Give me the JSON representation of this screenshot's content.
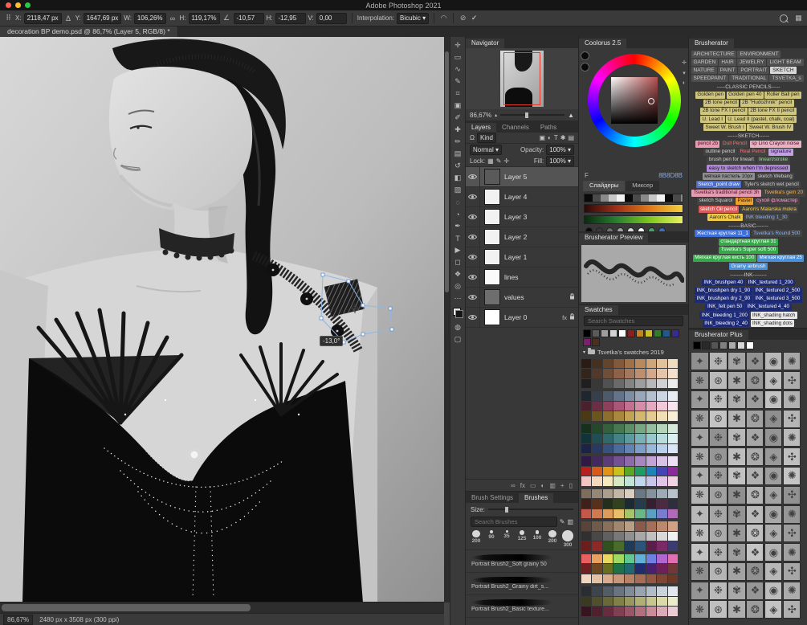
{
  "icons": {
    "ref_point": "⠿",
    "delta": "Δ",
    "link": "∞",
    "angle": "∠",
    "warp": "◠",
    "cancel": "⊘",
    "commit": "✓",
    "workspace": "▦",
    "dropdown": "▾",
    "expand": "▾",
    "filter_omega": "Ω",
    "f1": "▣",
    "f2": "◐",
    "f3": "T",
    "f4": "✱",
    "f5": "▤",
    "lock_transp": "▦",
    "lock_paint": "✎",
    "lock_move": "✛",
    "foot_link": "∞",
    "foot_fx": "fx",
    "foot_adj": "◐",
    "foot_mask": "▭",
    "foot_group": "▥",
    "foot_new": "+",
    "foot_del": "▯",
    "mountain_small": "▴",
    "mountain_big": "▲",
    "brush_edit": "✎",
    "brush_folder": "▥",
    "cool_r1": "✛",
    "cool_r2": "▾",
    "cool_r3": "◐"
  },
  "menubar": {
    "title": "Adobe Photoshop 2021"
  },
  "traffic_lights": {
    "red": "#ff5f57",
    "yellow": "#febc2e",
    "green": "#28c840"
  },
  "options_bar": {
    "x_label": "X:",
    "x_value": "2118,47 px",
    "y_label": "Y:",
    "y_value": "1647,69 px",
    "w_label": "W:",
    "w_value": "106,26%",
    "h_label": "H:",
    "h_value": "119,17%",
    "rotate_value": "-10,57",
    "skew_h_label": "H:",
    "skew_h_value": "-12,95",
    "skew_v_label": "V:",
    "skew_v_value": "0,00",
    "interp_label": "Interpolation:",
    "interp_value": "Bicubic"
  },
  "document_tab": {
    "title": "decoration BP demo.psd @ 86,7% (Layer 5, RGB/8) *"
  },
  "toolbar": {
    "tools": [
      {
        "name": "move-tool",
        "glyph": "✛"
      },
      {
        "name": "marquee-tool",
        "glyph": "▭"
      },
      {
        "name": "lasso-tool",
        "glyph": "∿"
      },
      {
        "name": "quick-selection-tool",
        "glyph": "✎"
      },
      {
        "name": "crop-tool",
        "glyph": "⌗"
      },
      {
        "name": "frame-tool",
        "glyph": "▣"
      },
      {
        "name": "eyedropper-tool",
        "glyph": "✐"
      },
      {
        "name": "healing-brush-tool",
        "glyph": "✚"
      },
      {
        "name": "brush-tool",
        "glyph": "✏"
      },
      {
        "name": "clone-stamp-tool",
        "glyph": "▤"
      },
      {
        "name": "history-brush-tool",
        "glyph": "↺"
      },
      {
        "name": "eraser-tool",
        "glyph": "◧"
      },
      {
        "name": "gradient-tool",
        "glyph": "▨"
      },
      {
        "name": "blur-tool",
        "glyph": "◌"
      },
      {
        "name": "dodge-tool",
        "glyph": "◔"
      },
      {
        "name": "pen-tool",
        "glyph": "✒"
      },
      {
        "name": "type-tool",
        "glyph": "T"
      },
      {
        "name": "path-selection-tool",
        "glyph": "▶"
      },
      {
        "name": "shape-tool",
        "glyph": "◻"
      },
      {
        "name": "hand-tool",
        "glyph": "❖"
      },
      {
        "name": "zoom-tool",
        "glyph": "◎"
      },
      {
        "name": "edit-toolbar",
        "glyph": "⋯"
      }
    ],
    "below_tools": [
      {
        "name": "quick-mask-toggle",
        "glyph": "◍"
      },
      {
        "name": "screen-mode-toggle",
        "glyph": "▢"
      }
    ]
  },
  "navigator": {
    "title": "Navigator",
    "zoom": "86,67%"
  },
  "layers_panel": {
    "tabs": [
      "Layers",
      "Channels",
      "Paths"
    ],
    "filter_label": "Kind",
    "blend_mode": "Normal",
    "opacity_label": "Opacity:",
    "opacity_value": "100%",
    "lock_label": "Lock:",
    "fill_label": "Fill:",
    "fill_value": "100%",
    "layers": [
      {
        "name": "Layer 5",
        "selected": true,
        "thumb": "#5a5a5a"
      },
      {
        "name": "Layer 4",
        "thumb": "#f2f2f2"
      },
      {
        "name": "Layer 3",
        "thumb": "#f2f2f2"
      },
      {
        "name": "Layer 2",
        "thumb": "#f2f2f2"
      },
      {
        "name": "Layer 1",
        "thumb": "#f2f2f2"
      },
      {
        "name": "lines",
        "thumb": "#fafafa"
      },
      {
        "name": "values",
        "thumb": "#6e6e6e",
        "locked": true
      },
      {
        "name": "Layer 0",
        "thumb": "#ffffff",
        "fx": true,
        "locked": true
      }
    ]
  },
  "brushes_panel": {
    "tabs": [
      "Brush Settings",
      "Brushes"
    ],
    "size_label": "Size:",
    "search_placeholder": "Search Brushes",
    "sizes": [
      "200",
      "90",
      "35",
      "125",
      "100",
      "200",
      "300"
    ],
    "brushes": [
      "Portrait Brush2_Soft grainy 50",
      "Portrait Brush2_Grainy dirt_s...",
      "Portrait Brush2_Basic texture..."
    ]
  },
  "coolorus": {
    "title": "Coolorus 2.5",
    "hex_prefix": "F",
    "hex_value": "8B8D8B",
    "tabs": [
      "Слайдеры",
      "Миксер"
    ],
    "dots": [
      "#0a0a0a",
      "#3a3a3a",
      "#6e6e6e",
      "#a2a2a2",
      "#d6d6d6",
      "#ffffff",
      "#4aa06a",
      "#3a6ec0"
    ]
  },
  "brusherator_preview": {
    "title": "Brusherator Preview"
  },
  "swatches_panel": {
    "title": "Swatches",
    "search_placeholder": "Search Swatches",
    "folder_name": "Tsvetka's swatches 2019",
    "standard": [
      "#000000",
      "#5a5a5a",
      "#9e9e9e",
      "#d4d4d4",
      "#ffffff",
      "#8c1f1f",
      "#c4841f",
      "#ccc01e",
      "#2e7c2e",
      "#1f5a8c",
      "#3a2a8c",
      "#7c1f6e",
      "#4a3020"
    ],
    "groups": [
      [
        "#2a1c14",
        "#46301f",
        "#64452c",
        "#82593a",
        "#a07048",
        "#b98a5e",
        "#cfa67a",
        "#e2c29a",
        "#f0dcc0"
      ],
      [
        "#33241c",
        "#52392b",
        "#6f4e3a",
        "#8c634a",
        "#a4785c",
        "#bc8f72",
        "#d2a98c",
        "#e4c4aa",
        "#f2dfcc"
      ],
      [
        "#1f1f1f",
        "#383838",
        "#515151",
        "#6a6a6a",
        "#848484",
        "#9e9e9e",
        "#b8b8b8",
        "#d2d2d2",
        "#ececec"
      ],
      [
        "#20262e",
        "#36404c",
        "#4c5a6a",
        "#647488",
        "#7e8ea2",
        "#98a8ba",
        "#b2c0d0",
        "#ccd6e2",
        "#e6ecf2"
      ],
      [
        "#4a1f2e",
        "#6b2e44",
        "#8c405c",
        "#a85876",
        "#c27290",
        "#d48eaa",
        "#e4aac2",
        "#f0c8d8",
        "#f8e4ec"
      ],
      [
        "#4a3a14",
        "#6b5420",
        "#8c6e2e",
        "#a8883e",
        "#c2a254",
        "#d4b870",
        "#e4cc90",
        "#f0deb4",
        "#f8eed8"
      ],
      [
        "#16301c",
        "#24482c",
        "#34603e",
        "#487852",
        "#5e9068",
        "#78a882",
        "#94be9e",
        "#b4d4bc",
        "#d6e8da"
      ],
      [
        "#10343a",
        "#204e52",
        "#30686c",
        "#448286",
        "#5c9aa0",
        "#78b2b6",
        "#96c8cc",
        "#b6dcde",
        "#daf0f2"
      ],
      [
        "#1a2448",
        "#283a64",
        "#385280",
        "#4c6a9c",
        "#6284b4",
        "#7c9eca",
        "#98b8dc",
        "#b8d0ec",
        "#dae6f6"
      ],
      [
        "#2e1a44",
        "#44295e",
        "#5c3c78",
        "#745292",
        "#8e6aac",
        "#a886c2",
        "#c2a4d6",
        "#d8c2e6",
        "#eee0f4"
      ],
      [
        "#b81f1f",
        "#d85a1a",
        "#e09418",
        "#ccc01e",
        "#5aa824",
        "#1e9c64",
        "#1e84b8",
        "#4444b4",
        "#8c2a9c"
      ],
      [
        "#f2c4c4",
        "#f4d8c0",
        "#f6e8c0",
        "#d8e8c2",
        "#c0e4d6",
        "#c0d8ee",
        "#c8c4ea",
        "#e2c4e6",
        "#f0d4e4"
      ],
      [
        "#7e6e5e",
        "#968676",
        "#ac9e8e",
        "#c2b6a6",
        "#d8cec0",
        "#6a7886",
        "#84929e",
        "#9eaab6",
        "#b8c2cc"
      ],
      [
        "#402018",
        "#58301c",
        "#242e1c",
        "#32421e",
        "#1c2a34",
        "#243c4c",
        "#34202e",
        "#4a2c42",
        "#2e2e3e"
      ],
      [
        "#c4584a",
        "#d07a52",
        "#dc9c5c",
        "#e8be6c",
        "#a8c46a",
        "#6ab888",
        "#5aa0c0",
        "#7a7ccc",
        "#b468b8"
      ],
      [
        "#58443a",
        "#705a4a",
        "#88705c",
        "#a08870",
        "#b8a086",
        "#8a5a4a",
        "#a4705a",
        "#bc886e",
        "#d2a084"
      ],
      [
        "#303030",
        "#484848",
        "#606060",
        "#787878",
        "#909090",
        "#a8a8a8",
        "#c0c0c0",
        "#d8d8d8",
        "#f0f0f0"
      ],
      [
        "#6a1e1e",
        "#8c2a2a",
        "#30501e",
        "#4a6c2a",
        "#1e3c5a",
        "#2a547c",
        "#5a1e4a",
        "#7c2a66",
        "#3c3c70"
      ],
      [
        "#e86060",
        "#e8a060",
        "#e8d860",
        "#a0d860",
        "#60c890",
        "#60b0d8",
        "#7080e0",
        "#b068d0",
        "#e070b0"
      ],
      [
        "#702020",
        "#704820",
        "#687020",
        "#207048",
        "#206870",
        "#202c70",
        "#482070",
        "#702058",
        "#703838"
      ],
      [
        "#f0d6c0",
        "#e4c0a4",
        "#d8ac8c",
        "#c89678",
        "#b88064",
        "#a86c52",
        "#945842",
        "#804634",
        "#6c3828"
      ],
      [
        "#2a2e34",
        "#3e444c",
        "#545c66",
        "#6a7480",
        "#828c98",
        "#9aa4b0",
        "#b2bcc6",
        "#cad2da",
        "#e2e8ee"
      ],
      [
        "#3a3a20",
        "#50502c",
        "#68683a",
        "#80804a",
        "#98985e",
        "#b0b074",
        "#c6c68e",
        "#dadaaa",
        "#ececcc"
      ],
      [
        "#381420",
        "#50202e",
        "#682c40",
        "#804054",
        "#985668",
        "#b07080",
        "#c88c9a",
        "#daaab6",
        "#ecccd4"
      ]
    ]
  },
  "brusherator": {
    "title": "Brusherator",
    "categories": [
      "ARCHITECTURE",
      "ENVIRONMENT",
      "GARDEN",
      "HAIR",
      "JEWELRY",
      "LIGHT BEAM",
      "NATURE",
      "PAINT",
      "PORTRAIT",
      "SKETCH",
      "SPEEDPAINT",
      "TRADITIONAL",
      "TSVETKA_s"
    ],
    "active_category": "SKETCH",
    "sections": [
      {
        "header": "-----CLASSIC PENCILS-----",
        "buttons": [
          {
            "label": "Golden pen",
            "bg": "#cfc57d",
            "fg": "#1c1c1c"
          },
          {
            "label": "Golden pen 40",
            "bg": "#cfc57d",
            "fg": "#1c1c1c"
          },
          {
            "label": "Roller Ball pen",
            "bg": "#cfc57d",
            "fg": "#1c1c1c"
          },
          {
            "label": "2B tone pencil",
            "bg": "#cfc57d",
            "fg": "#1c1c1c"
          },
          {
            "label": "2B \"Hudozhnik\" pencil",
            "bg": "#cfc57d",
            "fg": "#1c1c1c"
          },
          {
            "label": "2B tone FX I pencil",
            "bg": "#cfc57d",
            "fg": "#1c1c1c"
          },
          {
            "label": "2B tone FX II pencil",
            "bg": "#cfc57d",
            "fg": "#1c1c1c"
          },
          {
            "label": "U. Lead I",
            "bg": "#cfc57d",
            "fg": "#1c1c1c"
          },
          {
            "label": "U. Lead II (pastel, chalk, coal)",
            "bg": "#cfc57d",
            "fg": "#1c1c1c"
          },
          {
            "label": "Sweet W. Brush I",
            "bg": "#cfc57d",
            "fg": "#1c1c1c"
          },
          {
            "label": "Sweet W. Brush IV",
            "bg": "#cfc57d",
            "fg": "#1c1c1c"
          }
        ]
      },
      {
        "header": "------SKETCH------",
        "buttons": [
          {
            "label": "pencil 2b",
            "bg": "#e59cb2",
            "fg": "#4a0c20"
          },
          {
            "label": "Dull Pencil",
            "bg": "#424242",
            "fg": "#ff6a6a"
          },
          {
            "label": "sp Lino Crayon noise",
            "bg": "#e8b2c4",
            "fg": "#4a0c20"
          },
          {
            "label": "outline pencil",
            "bg": "#424242",
            "fg": "#cfcfcf"
          },
          {
            "label": "Real Pencil",
            "bg": "#424242",
            "fg": "#ff6a6a"
          },
          {
            "label": "signature",
            "bg": "#c2a0e4",
            "fg": "#2a0c40"
          },
          {
            "label": "brush pen for lineart",
            "bg": "#424242",
            "fg": "#cfcfcf"
          },
          {
            "label": "lineart/stroke",
            "bg": "#424242",
            "fg": "#8ee08e"
          },
          {
            "label": "easy to sketch when I'm depressed",
            "bg": "#b088d8",
            "fg": "#141414"
          },
          {
            "label": "мягкая пастель 10px",
            "bg": "#8e8e8e",
            "fg": "#141414"
          },
          {
            "label": "sketch Webang",
            "bg": "#424242",
            "fg": "#cfcfcf"
          },
          {
            "label": "Sketch_point draw",
            "bg": "#4a6ed0",
            "fg": "#ffffff"
          },
          {
            "label": "Tyler's sketch wet pencil",
            "bg": "#424242",
            "fg": "#cfcfcf"
          },
          {
            "label": "Tsvetka's traditional pencil 3h",
            "bg": "#e59cb2",
            "fg": "#4a0c20"
          },
          {
            "label": "Tsvetka's gem 20",
            "bg": "#424242",
            "fg": "#ffb347"
          },
          {
            "label": "sketch Squarol",
            "bg": "#424242",
            "fg": "#cfcfcf"
          },
          {
            "label": "Pastel",
            "bg": "#e8a030",
            "fg": "#1c1c1c"
          },
          {
            "label": "сухой фломастер",
            "bg": "#424242",
            "fg": "#ff9ecb"
          },
          {
            "label": "sketch Oil pencil",
            "bg": "#d85a5a",
            "fg": "#ffffff"
          },
          {
            "label": "Aaron's Malarska mokra",
            "bg": "#424242",
            "fg": "#ffd24a"
          },
          {
            "label": "Aaron's Chalk",
            "bg": "#f0cc4a",
            "fg": "#1c1c1c"
          },
          {
            "label": "INK bleeding 1_30",
            "bg": "#424242",
            "fg": "#8ab4ff"
          }
        ]
      },
      {
        "header": "-------BASIC-------",
        "buttons": [
          {
            "label": "Жесткая круглая 11_1",
            "bg": "#3f6fd8",
            "fg": "#ffffff"
          },
          {
            "label": "Tsvetka's Round 500",
            "bg": "#424242",
            "fg": "#8ab4ff"
          },
          {
            "label": "стандартная круглая 31",
            "bg": "#37a84a",
            "fg": "#ffffff"
          },
          {
            "label": "Tsvetka's Super soft 500",
            "bg": "#37a84a",
            "fg": "#ffffff"
          },
          {
            "label": "Мягкая круглая кисть 100",
            "bg": "#37a84a",
            "fg": "#ffffff"
          },
          {
            "label": "Мягкая круглая 25",
            "bg": "#4a90d8",
            "fg": "#ffffff"
          },
          {
            "label": "Grainy airbrush",
            "bg": "#4a90d8",
            "fg": "#ffffff"
          }
        ]
      },
      {
        "header": "--------INK--------",
        "buttons": [
          {
            "label": "INK_brushpen 40",
            "bg": "#1c2a78",
            "fg": "#ffffff"
          },
          {
            "label": "INK_textured 1_200",
            "bg": "#1c2a78",
            "fg": "#ffffff"
          },
          {
            "label": "INK_brushpen dry 1_90",
            "bg": "#1c2a78",
            "fg": "#ffffff"
          },
          {
            "label": "INK_textured 2_500",
            "bg": "#1c2a78",
            "fg": "#ffffff"
          },
          {
            "label": "INK_brushpen dry 2_90",
            "bg": "#1c2a78",
            "fg": "#ffffff"
          },
          {
            "label": "INK_textured 3_500",
            "bg": "#1c2a78",
            "fg": "#ffffff"
          },
          {
            "label": "INK_felt pen 50",
            "bg": "#1c2a78",
            "fg": "#ffffff"
          },
          {
            "label": "INK_textured 4_40",
            "bg": "#1c2a78",
            "fg": "#ffffff"
          },
          {
            "label": "INK_bleeding 1_200",
            "bg": "#1c2a78",
            "fg": "#ffffff"
          },
          {
            "label": "INK_shading hatch",
            "bg": "#e8e8e8",
            "fg": "#1c1c1c"
          },
          {
            "label": "INK_bleeding 2_40",
            "bg": "#1c2a78",
            "fg": "#ffffff"
          },
          {
            "label": "INK_shading dots",
            "bg": "#e8e8e8",
            "fg": "#1c1c1c"
          }
        ]
      }
    ]
  },
  "brusherator_plus": {
    "title": "Brusherator Plus",
    "swatch_row": [
      "#000000",
      "#2a2a2a",
      "#555555",
      "#808080",
      "#ababab",
      "#d6d6d6",
      "#ffffff"
    ],
    "thumb_glyphs": [
      "✦",
      "❉",
      "✾",
      "❖",
      "◉",
      "✺",
      "❋",
      "⊛",
      "✱",
      "❂",
      "◈",
      "✣"
    ],
    "thumb_count": 84
  },
  "status_bar": {
    "zoom": "86,67%",
    "doc_info": "2480 px x 3508 px (300 ppi)"
  },
  "transform_overlay": {
    "angle_badge": "-13,0°"
  }
}
